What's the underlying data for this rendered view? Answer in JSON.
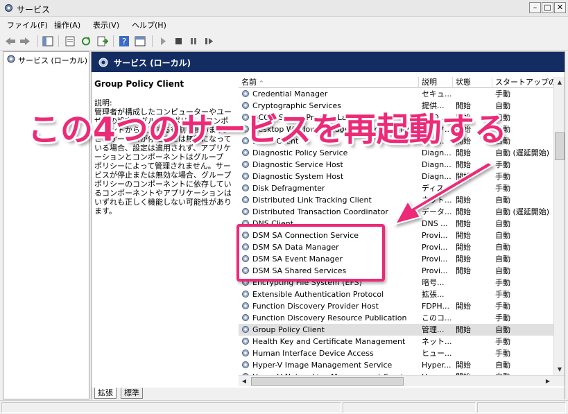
{
  "window": {
    "title": "サービス"
  },
  "menu": [
    "ファイル(F)",
    "操作(A)",
    "表示(V)",
    "ヘルプ(H)"
  ],
  "tree": {
    "root_label": "サービス (ローカル)"
  },
  "main": {
    "header_title": "サービス (ローカル)",
    "selected_service": "Group Policy Client",
    "desc_label": "説明:",
    "desc_text": "管理者が構成したコンピューターやユーザーの設定をグループ ポリシー コンポーネントから適用する役割を担います。このサービスが停止または無効になっている場合、設定は適用されず、アプリケーションとコンポーネントはグループ ポリシーによって管理されません。サービスが停止または無効な場合、グループ ポリシーのコンポーネントに依存しているコンポーネントやアプリケーションはいずれも正しく機能しない可能性があります。"
  },
  "columns": [
    "名前",
    "説明",
    "状態",
    "スタートアップの種類"
  ],
  "services": [
    {
      "name": "Credential Manager",
      "desc": "セキュ...",
      "status": "",
      "startup": "手動"
    },
    {
      "name": "Cryptographic Services",
      "desc": "提供...",
      "status": "開始",
      "startup": "自動"
    },
    {
      "name": "DCOM Server Process Launcher",
      "desc": "DCO...",
      "status": "開始",
      "startup": "自動"
    },
    {
      "name": "Desktop Window Manager Session Manager",
      "desc": "デスク...",
      "status": "開始",
      "startup": "自動"
    },
    {
      "name": "DHCP Client",
      "desc": "この...",
      "status": "開始",
      "startup": "自動"
    },
    {
      "name": "Diagnostic Policy Service",
      "desc": "Diagn...",
      "status": "開始",
      "startup": "自動 (遅延開始)"
    },
    {
      "name": "Diagnostic Service Host",
      "desc": "Diagn...",
      "status": "開始",
      "startup": "手動"
    },
    {
      "name": "Diagnostic System Host",
      "desc": "Diagn...",
      "status": "開始",
      "startup": "手動"
    },
    {
      "name": "Disk Defragmenter",
      "desc": "ディス...",
      "status": "",
      "startup": "手動"
    },
    {
      "name": "Distributed Link Tracking Client",
      "desc": "ネット...",
      "status": "開始",
      "startup": "自動"
    },
    {
      "name": "Distributed Transaction Coordinator",
      "desc": "データ...",
      "status": "開始",
      "startup": "自動 (遅延開始)"
    },
    {
      "name": "DNS Client",
      "desc": "DNS ...",
      "status": "開始",
      "startup": "自動"
    },
    {
      "name": "DSM SA Connection Service",
      "desc": "Provi...",
      "status": "開始",
      "startup": "自動"
    },
    {
      "name": "DSM SA Data Manager",
      "desc": "Provi...",
      "status": "開始",
      "startup": "自動"
    },
    {
      "name": "DSM SA Event Manager",
      "desc": "Provi...",
      "status": "開始",
      "startup": "自動"
    },
    {
      "name": "DSM SA Shared Services",
      "desc": "Provi...",
      "status": "開始",
      "startup": "自動"
    },
    {
      "name": "Encrypting File System (EFS)",
      "desc": "暗号...",
      "status": "",
      "startup": "手動"
    },
    {
      "name": "Extensible Authentication Protocol",
      "desc": "拡張...",
      "status": "",
      "startup": "手動"
    },
    {
      "name": "Function Discovery Provider Host",
      "desc": "FDPH...",
      "status": "開始",
      "startup": "手動"
    },
    {
      "name": "Function Discovery Resource Publication",
      "desc": "このコ...",
      "status": "",
      "startup": "手動"
    },
    {
      "name": "Group Policy Client",
      "desc": "管理...",
      "status": "開始",
      "startup": "自動",
      "selected": true
    },
    {
      "name": "Health Key and Certificate Management",
      "desc": "ネット...",
      "status": "",
      "startup": "手動"
    },
    {
      "name": "Human Interface Device Access",
      "desc": "ヒュー...",
      "status": "",
      "startup": "手動"
    },
    {
      "name": "Hyper-V Image Management Service",
      "desc": "Hyper...",
      "status": "開始",
      "startup": "自動"
    },
    {
      "name": "Hyper-V Networking Management Service",
      "desc": "Hyper...",
      "status": "開始",
      "startup": "自動"
    }
  ],
  "tabs": [
    "拡張",
    "標準"
  ],
  "annotation": {
    "text": "この4つのサービスを再起動する",
    "color": "#ec2a78"
  }
}
